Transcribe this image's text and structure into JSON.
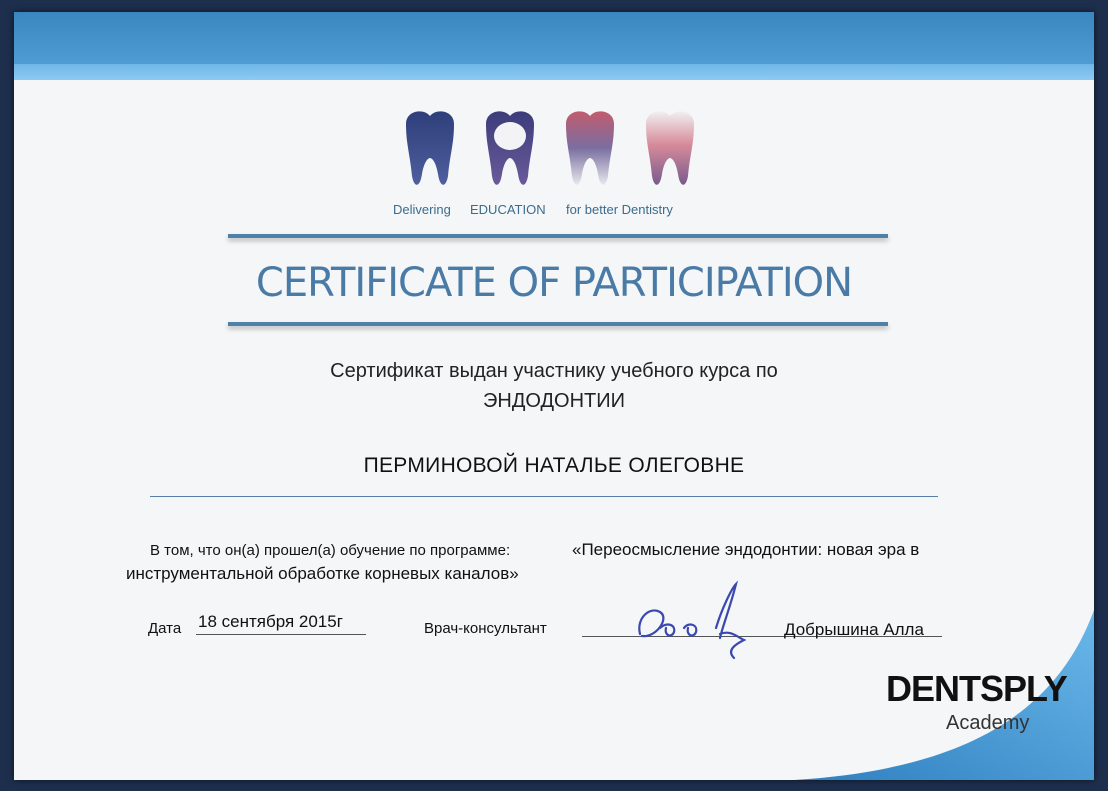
{
  "logo": {
    "taglines": [
      "Delivering",
      "EDUCATION",
      "for better Dentistry"
    ]
  },
  "certificate": {
    "title": "CERTIFICATE OF PARTICIPATION",
    "issued_line_1": "Сертификат выдан участнику учебного курса по",
    "issued_line_2": "ЭНДОДОНТИИ",
    "recipient": "ПЕРМИНОВОЙ НАТАЛЬЕ ОЛЕГОВНЕ",
    "program_intro": "В том, что он(а) прошел(а) обучение по программе:",
    "program_name_1": "«Переосмысление эндодонтии: новая эра в",
    "program_name_2": "инструментальной обработке корневых каналов»",
    "date_label": "Дата",
    "date_value": "18 сентября 2015г",
    "consultant_label": "Врач-консультант",
    "consultant_name": "Добрышина Алла"
  },
  "brand": {
    "dentsply": "DENTSPLY",
    "academy": "Academy"
  },
  "colors": {
    "band_dark": "#3a86c0",
    "band_light": "#8ccbf2",
    "title_blue": "#4a7aa6",
    "signature_ink": "#3a48b0"
  }
}
